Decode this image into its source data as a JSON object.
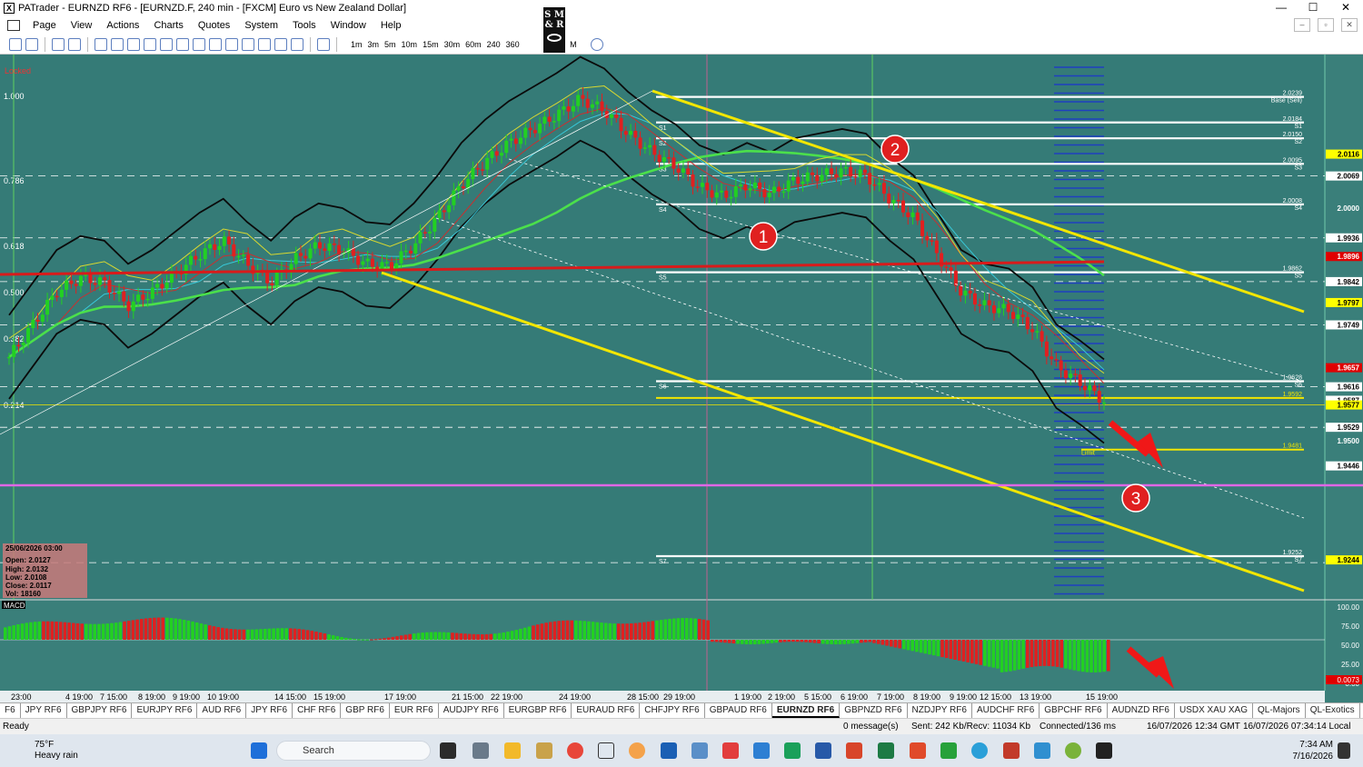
{
  "window": {
    "title": "PATrader - EURNZD RF6 - [EURNZD.F, 240 min - [FXCM] Euro vs New Zealand Dollar]",
    "min": "—",
    "max": "☐",
    "close": "✕"
  },
  "menu": [
    "Page",
    "View",
    "Actions",
    "Charts",
    "Quotes",
    "System",
    "Tools",
    "Window",
    "Help"
  ],
  "toolbar": {
    "timeframes": [
      "1m",
      "3m",
      "5m",
      "10m",
      "15m",
      "30m",
      "60m",
      "240",
      "360",
      "W",
      "M"
    ],
    "logo": "S M & R"
  },
  "chart": {
    "locked_label": "Locked",
    "fib_labels_left": [
      "1.000",
      "0.786",
      "0.618",
      "0.500",
      "0.382",
      "0.214"
    ],
    "level_tags": [
      "S1",
      "S2",
      "S3",
      "S4",
      "S5",
      "S6",
      "S7"
    ],
    "base_label": "Base (Sell)",
    "limit_label": "Limit",
    "annotations": [
      "1",
      "2",
      "3"
    ],
    "info_box": {
      "date": "25/06/2026 03:00",
      "open": "Open: 2.0127",
      "high": "High: 2.0132",
      "low": "Low: 2.0108",
      "close": "Close: 2.0117",
      "vol": "Vol: 18160"
    },
    "macd_label": "MACD",
    "x_ticks": [
      "23:00",
      "4 19:00",
      "7 15:00",
      "8 19:00",
      "9 19:00",
      "10 19:00",
      "14 15:00",
      "15 19:00",
      "17 19:00",
      "21 15:00",
      "22 19:00",
      "24 19:00",
      "28 15:00",
      "29 19:00",
      "1 19:00",
      "2 19:00",
      "5 15:00",
      "6 19:00",
      "7 19:00",
      "8 19:00",
      "9 19:00",
      "12 15:00",
      "13 19:00",
      "15 19:00"
    ]
  },
  "chart_data": {
    "type": "candlestick",
    "symbol": "EURNZD.F",
    "timeframe": "240 min",
    "ylim": [
      1.917,
      2.033
    ],
    "price_levels": [
      {
        "label": "2.0239",
        "value": 2.0239
      },
      {
        "label": "2.0184",
        "value": 2.0184
      },
      {
        "label": "2.0150",
        "value": 2.015
      },
      {
        "label": "2.0095",
        "value": 2.0095
      },
      {
        "label": "2.0008",
        "value": 2.0008
      },
      {
        "label": "1.9862",
        "value": 1.9862
      },
      {
        "label": "1.9628",
        "value": 1.9628
      },
      {
        "label": "1.9592",
        "value": 1.9592
      },
      {
        "label": "1.9481",
        "value": 1.9481
      },
      {
        "label": "1.9252",
        "value": 1.9252
      }
    ],
    "right_axis_tags": [
      {
        "label": "2.0116",
        "value": 2.0116,
        "color": "#ffff00"
      },
      {
        "label": "2.0069",
        "value": 2.0069,
        "color": "#ffffff"
      },
      {
        "label": "2.0000",
        "value": 2.0,
        "color": "none"
      },
      {
        "label": "1.9936",
        "value": 1.9936,
        "color": "#ffffff"
      },
      {
        "label": "1.9896",
        "value": 1.9896,
        "color": "#e00000"
      },
      {
        "label": "1.9842",
        "value": 1.9842,
        "color": "#ffffff"
      },
      {
        "label": "1.9797",
        "value": 1.9797,
        "color": "#ffff00"
      },
      {
        "label": "1.9749",
        "value": 1.9749,
        "color": "#ffffff"
      },
      {
        "label": "1.9657",
        "value": 1.9657,
        "color": "#e00000"
      },
      {
        "label": "1.9616",
        "value": 1.9616,
        "color": "#ffffff"
      },
      {
        "label": "1.9587",
        "value": 1.9587,
        "color": "#ffffff"
      },
      {
        "label": "1.9577",
        "value": 1.9577,
        "color": "#ffff00"
      },
      {
        "label": "1.9529",
        "value": 1.9529,
        "color": "#ffffff"
      },
      {
        "label": "1.9500",
        "value": 1.95,
        "color": "none"
      },
      {
        "label": "1.9446",
        "value": 1.9446,
        "color": "#ffffff"
      },
      {
        "label": "1.9244",
        "value": 1.9244,
        "color": "#ffff00"
      }
    ],
    "close_path": [
      1.968,
      1.975,
      1.982,
      1.985,
      1.984,
      1.979,
      1.982,
      1.986,
      1.99,
      1.993,
      1.988,
      1.984,
      1.989,
      1.992,
      1.991,
      1.988,
      1.9875,
      1.992,
      1.998,
      2.005,
      2.01,
      2.014,
      2.017,
      2.02,
      2.0235,
      2.021,
      2.016,
      2.012,
      2.009,
      2.0045,
      2.0025,
      2.005,
      2.003,
      2.006,
      2.007,
      2.008,
      2.007,
      2.002,
      1.998,
      1.99,
      1.982,
      1.979,
      1.978,
      1.974,
      1.966,
      1.9625,
      1.9585
    ],
    "macd": {
      "ylim": [
        -25,
        105
      ],
      "ticks": [
        100,
        75,
        50,
        25,
        0
      ],
      "bottom_tag": "0.0073"
    }
  }
}
